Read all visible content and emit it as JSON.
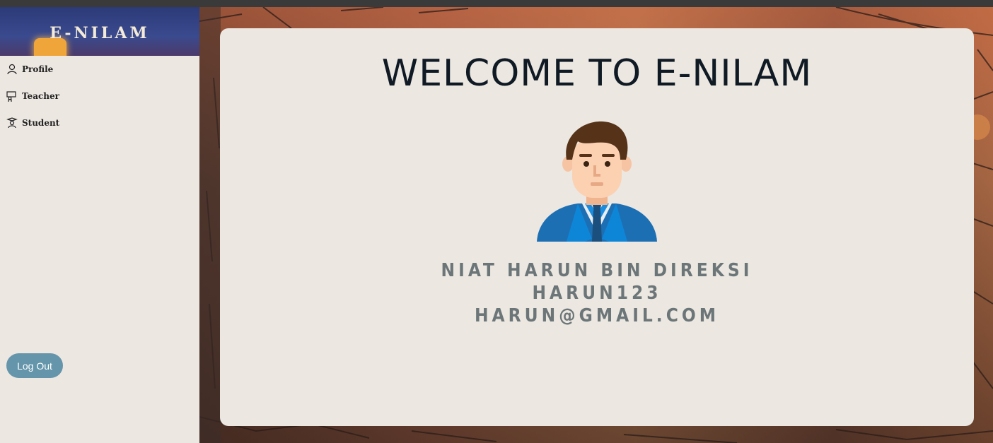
{
  "sidebar": {
    "brand": "E-NILAM",
    "items": [
      {
        "label": "Profile",
        "icon": "user-icon"
      },
      {
        "label": "Teacher",
        "icon": "teacher-icon"
      },
      {
        "label": "Student",
        "icon": "student-icon"
      }
    ],
    "logout_label": "Log Out"
  },
  "main": {
    "title": "WELCOME TO E-NILAM",
    "user": {
      "name": "NIAT HARUN BIN DIREKSI",
      "username": "HARUN123",
      "email": "HARUN@GMAIL.COM"
    }
  },
  "colors": {
    "sidebar_bg": "#ece7e1",
    "card_bg": "#ece7e1",
    "button": "#6495aa",
    "title": "#101a24",
    "info_text": "#6c7678"
  }
}
